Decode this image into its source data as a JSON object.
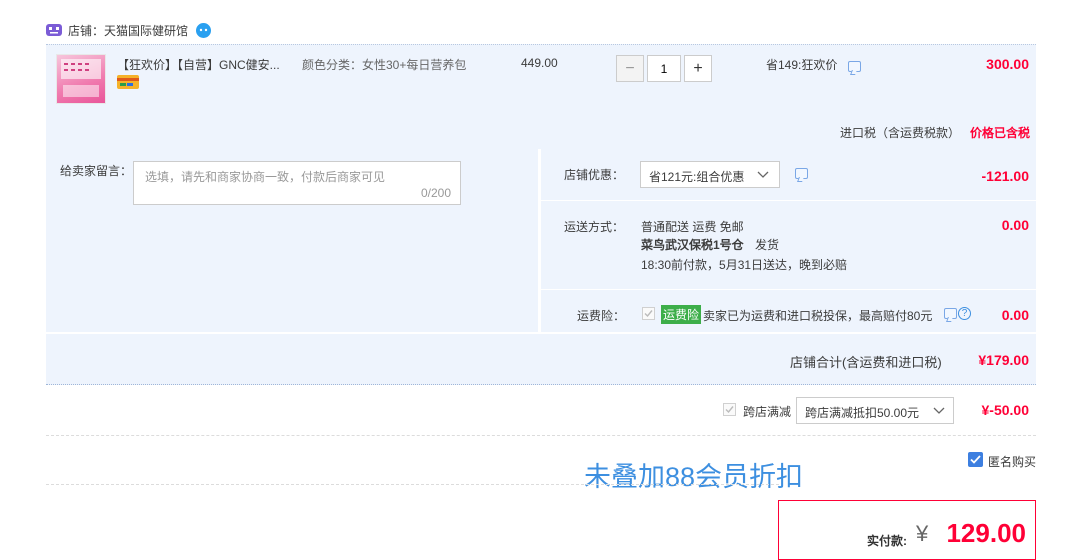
{
  "shop": {
    "label": "店铺：",
    "name": "天猫国际健研馆"
  },
  "item": {
    "title": "【狂欢价】【自营】GNC健安...",
    "sku": "颜色分类：女性30+每日营养包",
    "price": "449.00",
    "qty": "1",
    "minus": "−",
    "plus": "+",
    "promo": "省149:狂欢价",
    "subtotal": "300.00",
    "tax_label": "进口税（含运费税款）",
    "tax_value": "价格已含税"
  },
  "message": {
    "label": "给卖家留言：",
    "placeholder": "选填，请先和商家协商一致，付款后商家可见",
    "counter": "0/200"
  },
  "coupon": {
    "label": "店铺优惠：",
    "selected": "省121元:组合优惠",
    "value": "-121.00"
  },
  "shipping": {
    "label": "运送方式：",
    "line1": "普通配送 运费 免邮",
    "warehouse": "菜鸟武汉保税1号仓",
    "ship_text": "发货",
    "line3": "18:30前付款，5月31日送达，晚到必赔",
    "value": "0.00"
  },
  "insurance": {
    "label": "运费险：",
    "tag": "运费险",
    "text": "卖家已为运费和进口税投保，最高赔付80元",
    "value": "0.00"
  },
  "shop_total": {
    "label": "店铺合计(含运费和进口税)",
    "value": "¥179.00"
  },
  "cross_store": {
    "label": "跨店满减",
    "selected": "跨店满减抵扣50.00元",
    "value": "¥-50.00"
  },
  "overlay_text": "未叠加88会员折扣",
  "anonymous": {
    "label": "匿名购买"
  },
  "payment": {
    "label": "实付款:",
    "currency": "¥",
    "amount": "129.00"
  },
  "colors": {
    "accent_red": "#ff0036",
    "panel_blue": "#eef4fd",
    "overlay_blue": "#3d8fe0"
  }
}
